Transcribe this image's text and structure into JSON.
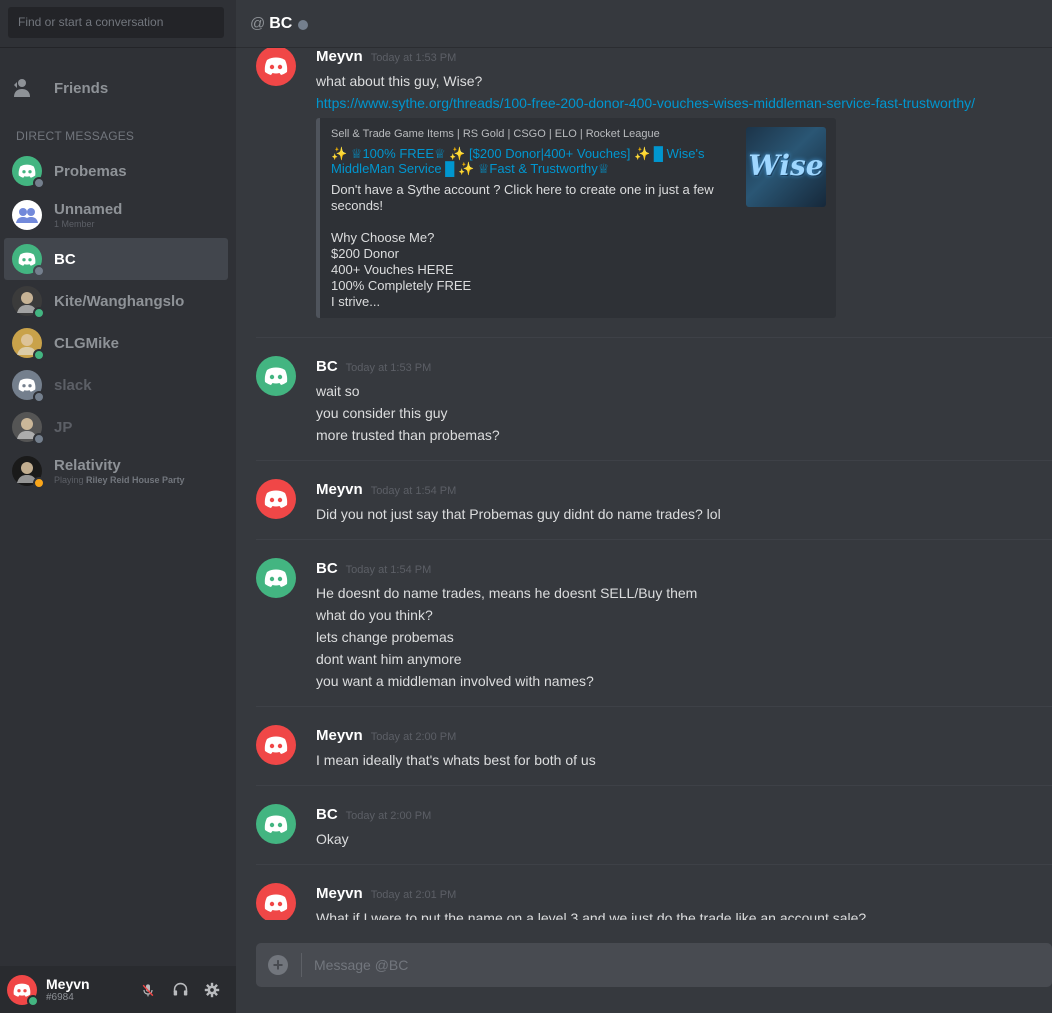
{
  "search": {
    "placeholder": "Find or start a conversation"
  },
  "friends_label": "Friends",
  "dm_header": "DIRECT MESSAGES",
  "dms": [
    {
      "name": "Probemas",
      "sub": "",
      "status": "offline",
      "avatar_color": "#43b581"
    },
    {
      "name": "Unnamed",
      "sub": "1 Member",
      "status": "",
      "avatar_color": "#7289da"
    },
    {
      "name": "BC",
      "sub": "",
      "status": "offline",
      "avatar_color": "#43b581"
    },
    {
      "name": "Kite/Wanghangslo",
      "sub": "",
      "status": "online",
      "avatar_color": "#3b3b3b"
    },
    {
      "name": "CLGMike",
      "sub": "",
      "status": "online",
      "avatar_color": "#c9a24a"
    },
    {
      "name": "slack",
      "sub": "",
      "status": "offline",
      "avatar_color": "#747f8d"
    },
    {
      "name": "JP",
      "sub": "",
      "status": "offline",
      "avatar_color": "#555555"
    },
    {
      "name": "Relativity",
      "sub_prefix": "Playing ",
      "sub_game": "Riley Reid House Party",
      "status": "idle",
      "avatar_color": "#1a1a1a"
    }
  ],
  "user": {
    "name": "Meyvn",
    "tag": "#6984"
  },
  "channel": {
    "at": "@",
    "title": "BC"
  },
  "messages": [
    {
      "author": "Meyvn",
      "time": "Today at 1:53 PM",
      "avatar_color": "#f04747",
      "lines": [
        "what about this guy, Wise?"
      ],
      "link": "https://www.sythe.org/threads/100-free-200-donor-400-vouches-wises-middleman-service-fast-trustworthy/",
      "embed": {
        "provider": "Sell & Trade Game Items | RS Gold | CSGO | ELO | Rocket League",
        "title": "✨ ♕100% FREE♕ ✨ [$200 Donor|400+ Vouches] ✨ █ Wise's MiddleMan Service █ ✨ ♕Fast & Trustworthy♕",
        "description": "Don't have a Sythe account ? Click here to create one in just a few seconds!\n\nWhy Choose Me?\n$200 Donor\n400+ Vouches HERE\n100% Completely FREE\nI strive...",
        "thumbnail_text": "Wise"
      }
    },
    {
      "author": "BC",
      "time": "Today at 1:53 PM",
      "avatar_color": "#43b581",
      "lines": [
        "wait so",
        "you consider this guy",
        "more trusted than probemas?"
      ]
    },
    {
      "author": "Meyvn",
      "time": "Today at 1:54 PM",
      "avatar_color": "#f04747",
      "lines": [
        "Did you not just say that Probemas guy didnt do name trades? lol"
      ]
    },
    {
      "author": "BC",
      "time": "Today at 1:54 PM",
      "avatar_color": "#43b581",
      "lines": [
        "He doesnt do name trades, means he doesnt SELL/Buy them",
        "what do you think?",
        "lets change probemas",
        "dont want him anymore",
        "you want a middleman involved with names?"
      ]
    },
    {
      "author": "Meyvn",
      "time": "Today at 2:00 PM",
      "avatar_color": "#f04747",
      "lines": [
        "I mean ideally that's whats best for both of us"
      ]
    },
    {
      "author": "BC",
      "time": "Today at 2:00 PM",
      "avatar_color": "#43b581",
      "lines": [
        "Okay"
      ]
    },
    {
      "author": "Meyvn",
      "time": "Today at 2:01 PM",
      "avatar_color": "#f04747",
      "lines": [
        "What if I were to put the name on a level 3 and we just do the trade like an account sale?"
      ]
    }
  ],
  "composer": {
    "placeholder": "Message @BC"
  }
}
